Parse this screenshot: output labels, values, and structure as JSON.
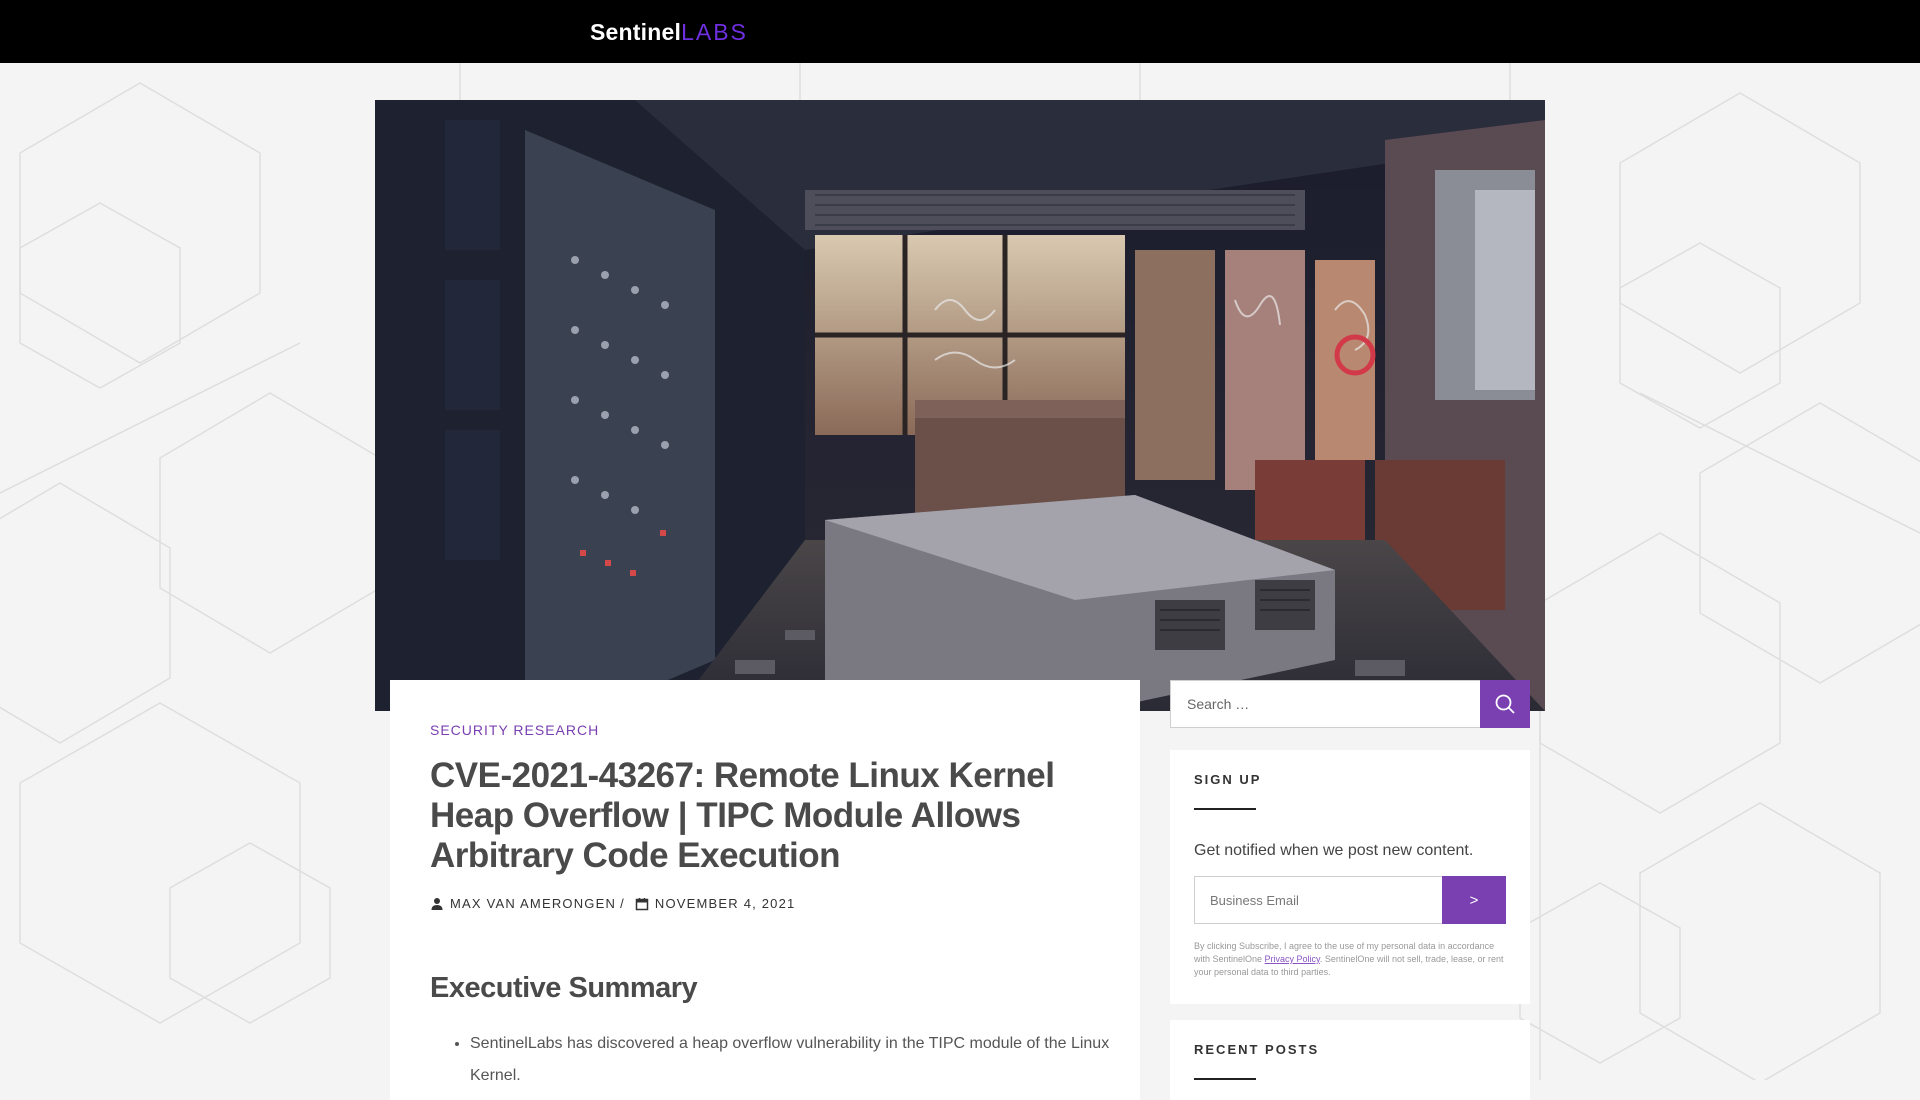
{
  "brand": {
    "name_primary": "Sentinel",
    "name_secondary": "LABS",
    "accent": "#7a3fb0",
    "logo_accent": "#6e2fe0"
  },
  "hero": {
    "alt": "Abandoned control room with graffiti covered walls"
  },
  "article": {
    "category": "SECURITY RESEARCH",
    "title": "CVE-2021-43267: Remote Linux Kernel Heap Overflow | TIPC Module Allows Arbitrary Code Execution",
    "author": "MAX VAN AMERONGEN",
    "date": "NOVEMBER 4, 2021",
    "meta_separator": "/",
    "section_heading": "Executive Summary",
    "bullets": [
      "SentinelLabs has discovered a heap overflow vulnerability in the TIPC module of the Linux Kernel."
    ],
    "icons": {
      "author": "user-icon",
      "date": "calendar-icon"
    }
  },
  "search": {
    "placeholder": "Search …",
    "icon": "search-icon"
  },
  "signup": {
    "title": "SIGN UP",
    "description": "Get notified when we post new content.",
    "email_placeholder": "Business Email",
    "submit_label": ">",
    "legal_prefix": "By clicking Subscribe, I agree to the use of my personal data in accordance with SentinelOne ",
    "legal_link": "Privacy Policy",
    "legal_suffix": ". SentinelOne will not sell, trade, lease, or rent your personal data to third parties."
  },
  "recent_posts": {
    "title": "RECENT POSTS"
  }
}
